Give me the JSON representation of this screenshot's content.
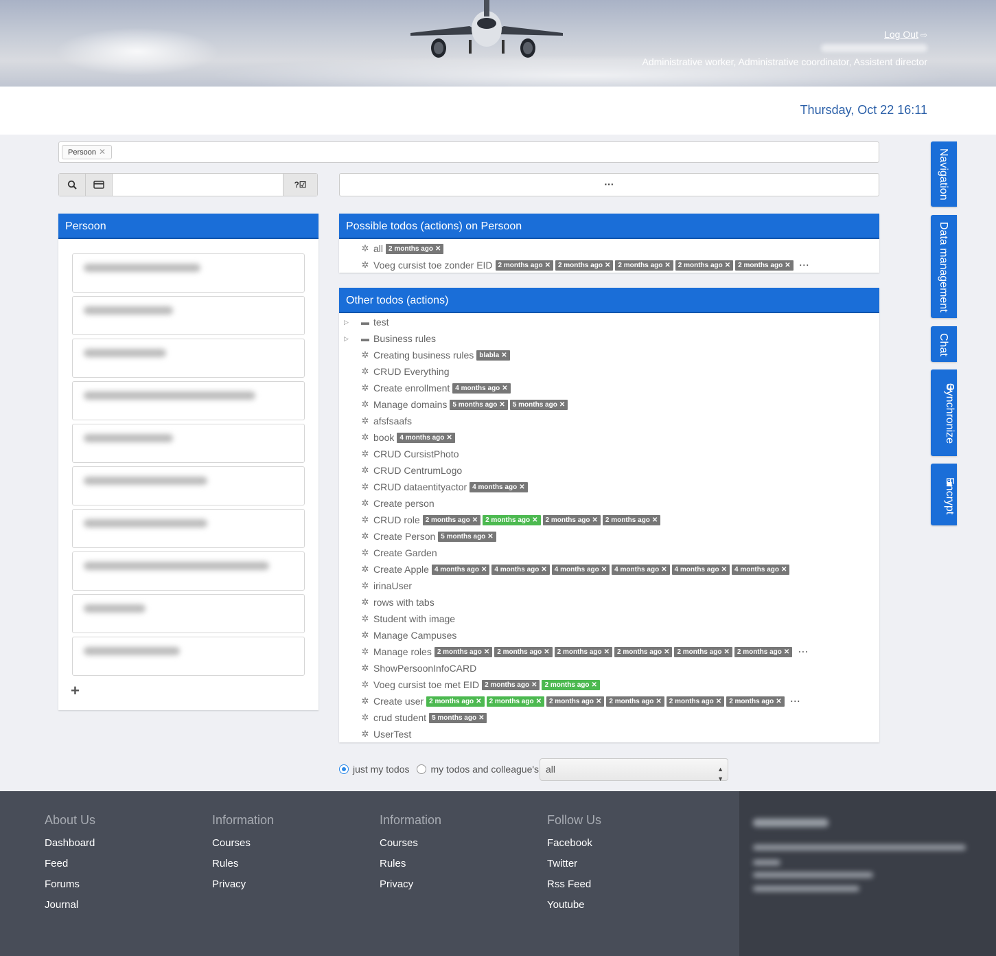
{
  "header": {
    "logout_label": "Log Out",
    "roles": "Administrative worker, Administrative coordinator, Assistent director",
    "date": "Thursday, Oct 22 16:11"
  },
  "tagbar": {
    "tag": "Persoon"
  },
  "search": {
    "help_label": "?☑",
    "more_label": "···"
  },
  "persoon_panel": {
    "title": "Persoon",
    "card_count": 10
  },
  "possible_panel": {
    "title": "Possible todos (actions) on Persoon",
    "items": [
      {
        "label": "all",
        "badges": [
          "2 months ago"
        ]
      },
      {
        "label": "Voeg cursist toe zonder EID",
        "badges": [
          "2 months ago",
          "2 months ago",
          "2 months ago",
          "2 months ago",
          "2 months ago"
        ],
        "more": "···"
      }
    ]
  },
  "other_panel": {
    "title": "Other todos (actions)",
    "folders": [
      "test",
      "Business rules"
    ],
    "items": [
      {
        "label": "Creating business rules",
        "badges": [
          "blabla"
        ]
      },
      {
        "label": "CRUD Everything"
      },
      {
        "label": "Create enrollment",
        "badges": [
          "4 months ago"
        ]
      },
      {
        "label": "Manage domains",
        "badges": [
          "5 months ago",
          "5 months ago"
        ]
      },
      {
        "label": "afsfsaafs"
      },
      {
        "label": "book",
        "badges": [
          "4 months ago"
        ]
      },
      {
        "label": "CRUD CursistPhoto"
      },
      {
        "label": "CRUD CentrumLogo"
      },
      {
        "label": "CRUD dataentityactor",
        "badges": [
          "4 months ago"
        ]
      },
      {
        "label": "Create person"
      },
      {
        "label": "CRUD role",
        "badges": [
          "2 months ago",
          "2 months ago",
          "2 months ago",
          "2 months ago"
        ]
      },
      {
        "label": "Create Person",
        "badges": [
          "5 months ago"
        ]
      },
      {
        "label": "Create Garden"
      },
      {
        "label": "Create Apple",
        "badges": [
          "4 months ago",
          "4 months ago",
          "4 months ago",
          "4 months ago",
          "4 months ago",
          "4 months ago"
        ]
      },
      {
        "label": "irinaUser"
      },
      {
        "label": "rows with tabs"
      },
      {
        "label": "Student with image"
      },
      {
        "label": "Manage Campuses"
      },
      {
        "label": "Manage roles",
        "badges": [
          "2 months ago",
          "2 months ago",
          "2 months ago",
          "2 months ago",
          "2 months ago",
          "2 months ago"
        ],
        "more": "···"
      },
      {
        "label": "ShowPersoonInfoCARD"
      },
      {
        "label": "Voeg cursist toe met EID",
        "badges": [
          "2 months ago",
          "2 months ago"
        ]
      },
      {
        "label": "Create user",
        "badges": [
          "2 months ago",
          "2 months ago",
          "2 months ago",
          "2 months ago",
          "2 months ago",
          "2 months ago"
        ],
        "more": "···"
      },
      {
        "label": "crud student",
        "badges": [
          "5 months ago"
        ]
      },
      {
        "label": "UserTest"
      }
    ]
  },
  "filter": {
    "option1": "just my todos",
    "option2": "my todos and colleague's",
    "select_value": "all"
  },
  "side_tabs": [
    "Navigation",
    "Data management",
    "Chat",
    "Synchronize",
    "Encrypt"
  ],
  "footer": {
    "columns": [
      {
        "title": "About Us",
        "links": [
          "Dashboard",
          "Feed",
          "Forums",
          "Journal"
        ]
      },
      {
        "title": "Information",
        "links": [
          "Courses",
          "Rules",
          "Privacy"
        ]
      },
      {
        "title": "Information",
        "links": [
          "Courses",
          "Rules",
          "Privacy"
        ]
      },
      {
        "title": "Follow Us",
        "links": [
          "Facebook",
          "Twitter",
          "Rss Feed",
          "Youtube"
        ]
      }
    ]
  },
  "colors": {
    "primary": "#1a6ed8",
    "badge_gray": "#777777",
    "badge_green": "#4cb950",
    "footer": "#484d58"
  }
}
